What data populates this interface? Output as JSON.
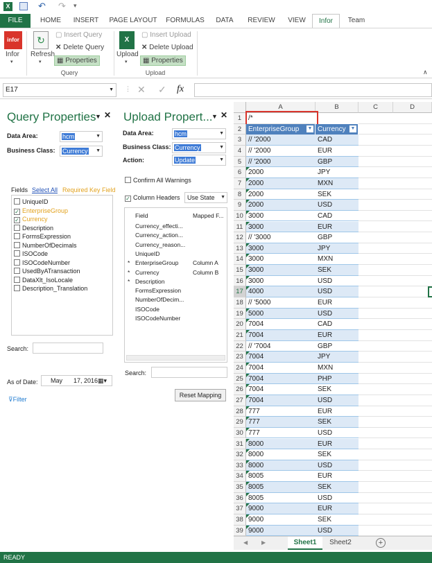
{
  "qat": {
    "save_icon": "save-icon",
    "undo_icon": "undo-icon",
    "redo_icon": "redo-icon"
  },
  "tabs": [
    "FILE",
    "HOME",
    "INSERT",
    "PAGE LAYOUT",
    "FORMULAS",
    "DATA",
    "REVIEW",
    "VIEW",
    "Infor",
    "Team"
  ],
  "ribbon": {
    "infor_label": "Infor",
    "logo_text": "infor",
    "refresh_label": "Refresh",
    "insert_query": "Insert Query",
    "delete_query": "Delete Query",
    "properties": "Properties",
    "query_group": "Query",
    "upload_label": "Upload",
    "insert_upload": "Insert Upload",
    "delete_upload": "Delete Upload",
    "properties2": "Properties",
    "upload_group": "Upload"
  },
  "formula_bar": {
    "name_box": "E17",
    "fx": "fx",
    "value": ""
  },
  "query_panel": {
    "title": "Query Properties",
    "data_area_label": "Data Area:",
    "data_area_value": "hcm",
    "business_class_label": "Business Class:",
    "business_class_value": "Currency",
    "fields_label": "Fields",
    "select_all": "Select All",
    "required_key": "Required Key Field",
    "fields": [
      {
        "name": "UniqueID",
        "checked": false,
        "key": false
      },
      {
        "name": "EnterpriseGroup",
        "checked": true,
        "key": true
      },
      {
        "name": "Currency",
        "checked": true,
        "key": true
      },
      {
        "name": "Description",
        "checked": false,
        "key": false
      },
      {
        "name": "FormsExpression",
        "checked": false,
        "key": false
      },
      {
        "name": "NumberOfDecimals",
        "checked": false,
        "key": false
      },
      {
        "name": "ISOCode",
        "checked": false,
        "key": false
      },
      {
        "name": "ISOCodeNumber",
        "checked": false,
        "key": false
      },
      {
        "name": "UsedByATransaction",
        "checked": false,
        "key": false
      },
      {
        "name": "DataXlt_IsoLocale",
        "checked": false,
        "key": false
      },
      {
        "name": "Description_Translation",
        "checked": false,
        "key": false
      }
    ],
    "search_label": "Search:",
    "as_of_label": "As of Date:",
    "as_of_month": "May",
    "as_of_rest": "17, 2016",
    "filter": "Filter"
  },
  "upload_panel": {
    "title": "Upload Propert...",
    "data_area_label": "Data Area:",
    "data_area_value": "hcm",
    "business_class_label": "Business Class:",
    "business_class_value": "Currency",
    "action_label": "Action:",
    "action_value": "Update",
    "confirm_warnings": "Confirm All Warnings",
    "column_headers": "Column Headers",
    "use_state": "Use State",
    "col_field": "Field",
    "col_mapped": "Mapped F...",
    "fields": [
      {
        "star": "",
        "name": "Currency_effecti...",
        "mapped": ""
      },
      {
        "star": "",
        "name": "Currency_action...",
        "mapped": ""
      },
      {
        "star": "",
        "name": "Currency_reason...",
        "mapped": ""
      },
      {
        "star": "",
        "name": "UniqueID",
        "mapped": ""
      },
      {
        "star": "*",
        "name": "EnterpriseGroup",
        "mapped": "Column A"
      },
      {
        "star": "*",
        "name": "Currency",
        "mapped": "Column B"
      },
      {
        "star": "*",
        "name": "Description",
        "mapped": ""
      },
      {
        "star": "",
        "name": "FormsExpression",
        "mapped": ""
      },
      {
        "star": "",
        "name": "NumberOfDecim...",
        "mapped": ""
      },
      {
        "star": "",
        "name": "ISOCode",
        "mapped": ""
      },
      {
        "star": "",
        "name": "ISOCodeNumber",
        "mapped": ""
      }
    ],
    "search_label": "Search:",
    "reset_mapping": "Reset Mapping"
  },
  "sheet": {
    "columns": [
      "A",
      "B",
      "C",
      "D"
    ],
    "a1": "/*",
    "header_a": "EnterpriseGroup",
    "header_b": "Currency",
    "rows": [
      [
        "// '2000",
        "CAD"
      ],
      [
        "// '2000",
        "EUR"
      ],
      [
        "// '2000",
        "GBP"
      ],
      [
        "2000",
        "JPY"
      ],
      [
        "2000",
        "MXN"
      ],
      [
        "2000",
        "SEK"
      ],
      [
        "2000",
        "USD"
      ],
      [
        "3000",
        "CAD"
      ],
      [
        "3000",
        "EUR"
      ],
      [
        "// '3000",
        "GBP"
      ],
      [
        "3000",
        "JPY"
      ],
      [
        "3000",
        "MXN"
      ],
      [
        "3000",
        "SEK"
      ],
      [
        "3000",
        "USD"
      ],
      [
        "4000",
        "USD"
      ],
      [
        "// '5000",
        "EUR"
      ],
      [
        "5000",
        "USD"
      ],
      [
        "7004",
        "CAD"
      ],
      [
        "7004",
        "EUR"
      ],
      [
        "// '7004",
        "GBP"
      ],
      [
        "7004",
        "JPY"
      ],
      [
        "7004",
        "MXN"
      ],
      [
        "7004",
        "PHP"
      ],
      [
        "7004",
        "SEK"
      ],
      [
        "7004",
        "USD"
      ],
      [
        "777",
        "EUR"
      ],
      [
        "777",
        "SEK"
      ],
      [
        "777",
        "USD"
      ],
      [
        "8000",
        "EUR"
      ],
      [
        "8000",
        "SEK"
      ],
      [
        "8000",
        "USD"
      ],
      [
        "8005",
        "EUR"
      ],
      [
        "8005",
        "SEK"
      ],
      [
        "8005",
        "USD"
      ],
      [
        "9000",
        "EUR"
      ],
      [
        "9000",
        "SEK"
      ],
      [
        "9000",
        "USD"
      ]
    ],
    "selected_row": 17,
    "tabs": [
      "Sheet1",
      "Sheet2"
    ],
    "add_sheet": "+"
  },
  "status": "READY",
  "colors": {
    "excel_green": "#217346",
    "table_header": "#4f81bd",
    "band": "#dde9f6",
    "highlight": "#d9342b"
  }
}
